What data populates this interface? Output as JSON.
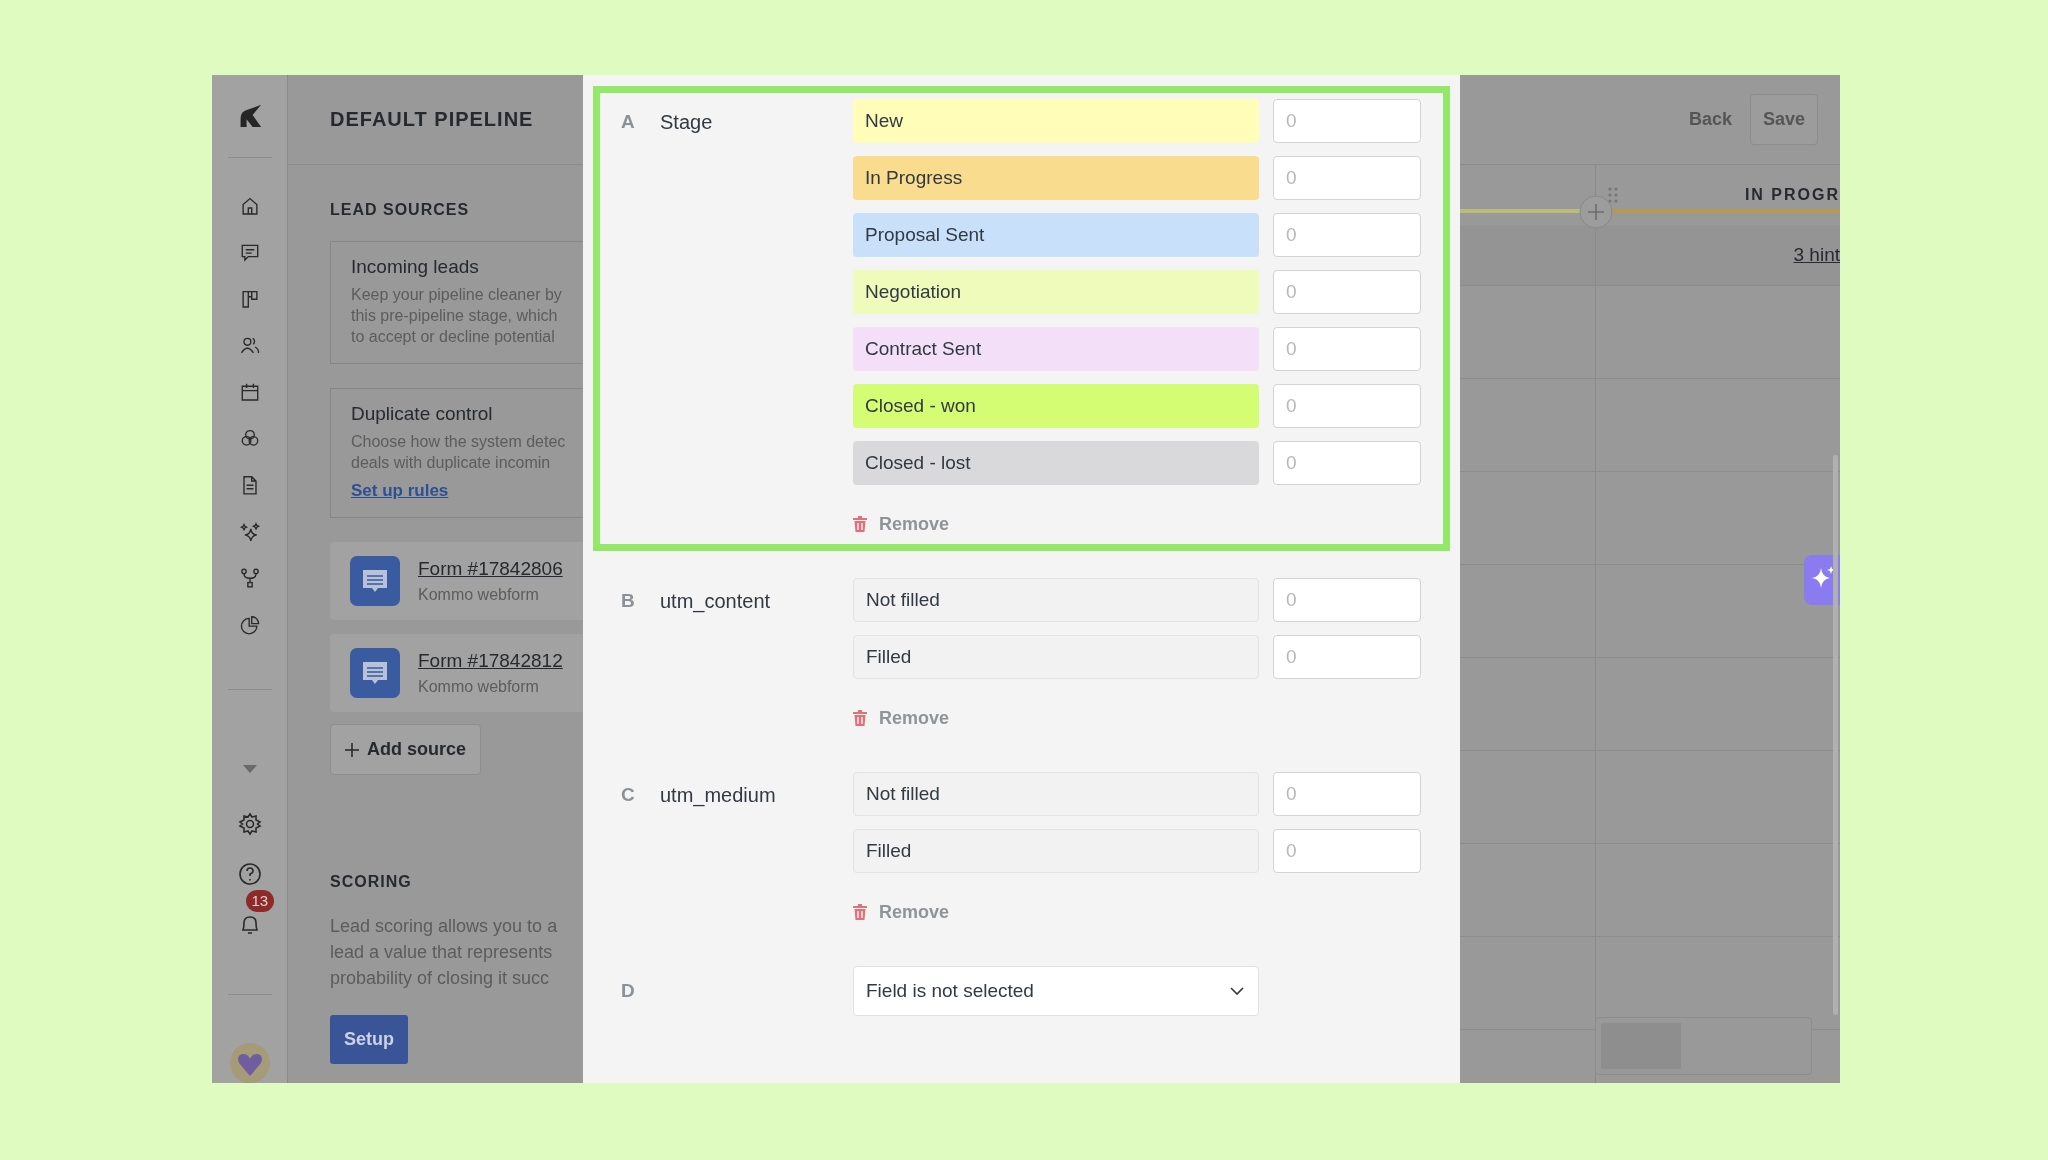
{
  "sidebar": {
    "notification_badge": "13"
  },
  "pipeline_panel": {
    "title": "DEFAULT PIPELINE",
    "lead_sources": {
      "heading": "LEAD SOURCES",
      "cards": [
        {
          "title": "Incoming leads",
          "description": "Keep your pipeline cleaner by\nthis pre-pipeline stage, which\nto accept or decline potential"
        },
        {
          "title": "Duplicate control",
          "description": "Choose how the system detec\ndeals with duplicate incomin",
          "link": "Set up rules"
        }
      ],
      "forms": [
        {
          "name": "Form #17842806",
          "subtitle": "Kommo webform"
        },
        {
          "name": "Form #17842812",
          "subtitle": "Kommo webform"
        }
      ],
      "add_button": "Add source"
    },
    "scoring": {
      "heading": "SCORING",
      "description": "Lead scoring allows you to a\nlead a value that represents\nprobability of closing it succ",
      "button": "Setup"
    }
  },
  "modal": {
    "sections": [
      {
        "letter": "A",
        "kind": "options",
        "label": "Stage",
        "highlighted": true,
        "remove": "Remove",
        "options": [
          {
            "label": "New",
            "color": "#fffdb8",
            "placeholder": "0"
          },
          {
            "label": "In Progress",
            "color": "#f9dc8e",
            "placeholder": "0"
          },
          {
            "label": "Proposal Sent",
            "color": "#c9e0fb",
            "placeholder": "0"
          },
          {
            "label": "Negotiation",
            "color": "#eefbba",
            "placeholder": "0"
          },
          {
            "label": "Contract Sent",
            "color": "#f4dff9",
            "placeholder": "0"
          },
          {
            "label": "Closed - won",
            "color": "#d5fd74",
            "placeholder": "0"
          },
          {
            "label": "Closed - lost",
            "color": "#d9d9dc",
            "placeholder": "0"
          }
        ]
      },
      {
        "letter": "B",
        "kind": "options",
        "label": "utm_content",
        "highlighted": false,
        "remove": "Remove",
        "options": [
          {
            "label": "Not filled",
            "placeholder": "0"
          },
          {
            "label": "Filled",
            "placeholder": "0"
          }
        ]
      },
      {
        "letter": "C",
        "kind": "options",
        "label": "utm_medium",
        "highlighted": false,
        "remove": "Remove",
        "options": [
          {
            "label": "Not filled",
            "placeholder": "0"
          },
          {
            "label": "Filled",
            "placeholder": "0"
          }
        ]
      },
      {
        "letter": "D",
        "kind": "select",
        "value": "Field is not selected"
      }
    ]
  },
  "header_actions": {
    "back": "Back",
    "save": "Save"
  },
  "board": {
    "column_title": "IN PROGR",
    "hint_link": "3 hint"
  }
}
